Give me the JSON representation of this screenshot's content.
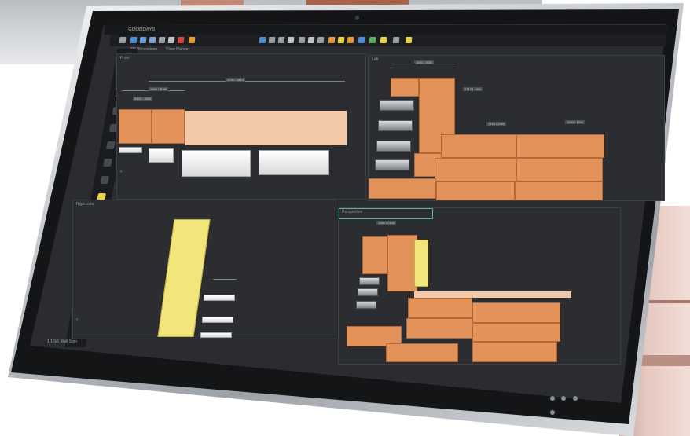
{
  "app": {
    "title": "GOODDAYS"
  },
  "tabs": [
    "3D Dimensions",
    "Floor Planner"
  ],
  "toolbar": {
    "icons": [
      "app-icon",
      "save-icon",
      "open-icon",
      "undo-icon",
      "redo-icon",
      "print-icon",
      "export-icon",
      "cut-icon",
      "select-icon",
      "move-icon",
      "rotate-icon",
      "measure-icon",
      "camera-icon",
      "render-icon",
      "layers-icon",
      "catalog-icon",
      "material-icon",
      "light-icon",
      "settings-icon"
    ],
    "colors": {
      "blue": "#4d8fd6",
      "orange": "#e59a3b",
      "yellow": "#e9d34a",
      "green": "#58b35a",
      "red": "#d04a3a"
    }
  },
  "viewports": {
    "top_left": {
      "label": "Front",
      "dims": [
        "2230 / 3810",
        "1650 / 3055",
        "3400 / 3890"
      ]
    },
    "top_right": {
      "label": "Left",
      "dims": [
        "1400 / 3000",
        "1710 / 1900",
        "1710 / 1900",
        "1900 / 1000"
      ]
    },
    "bottom_left": {
      "label": "Right side"
    },
    "bottom_right": {
      "label": "Perspective",
      "dims": [
        "1960 / 2100"
      ]
    }
  },
  "status": {
    "text": "1/1  0/1  Wall  Sqm"
  },
  "colors": {
    "screen_bg": "#2a2c30",
    "orange_panel": "#e3935a",
    "peach_panel": "#f3c9a9",
    "yellow_panel": "#f2e67a",
    "accent_teal": "#4fb6a8"
  }
}
